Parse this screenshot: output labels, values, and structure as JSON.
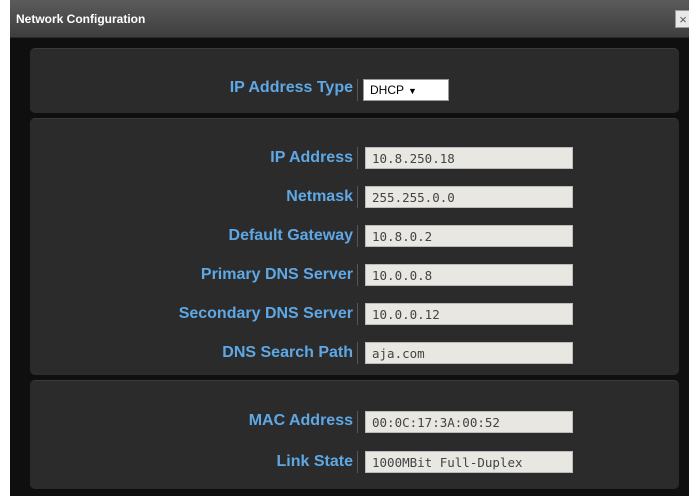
{
  "window": {
    "title": "Network Configuration",
    "close_glyph": "×"
  },
  "ip_type": {
    "label": "IP Address Type",
    "value": "DHCP",
    "arrow": "▼"
  },
  "network": [
    {
      "label": "IP Address",
      "value": "10.8.250.18"
    },
    {
      "label": "Netmask",
      "value": "255.255.0.0"
    },
    {
      "label": "Default Gateway",
      "value": "10.8.0.2"
    },
    {
      "label": "Primary DNS Server",
      "value": "10.0.0.8"
    },
    {
      "label": "Secondary DNS Server",
      "value": "10.0.0.12"
    },
    {
      "label": "DNS Search Path",
      "value": "aja.com"
    }
  ],
  "hardware": [
    {
      "label": "MAC Address",
      "value": "00:0C:17:3A:00:52"
    },
    {
      "label": "Link State",
      "value": "1000MBit Full-Duplex"
    }
  ],
  "colors": {
    "label": "#5fa8e6",
    "panel": "#2b2b2b",
    "background": "#0f0f0f"
  }
}
